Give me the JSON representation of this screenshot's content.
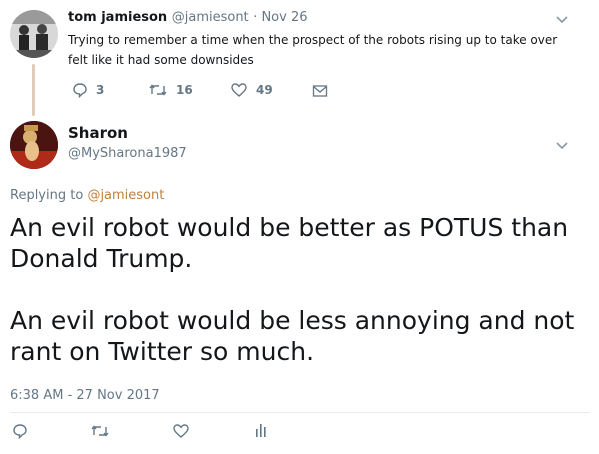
{
  "parent_tweet": {
    "name": "tom jamieson",
    "handle": "@jamiesont",
    "date": "· Nov 26",
    "text": "Trying to remember a time when the prospect of the robots rising up to take over felt like it had some downsides",
    "reply_count": "3",
    "retweet_count": "16",
    "like_count": "49"
  },
  "main_tweet": {
    "name": "Sharon",
    "handle": "@MySharona1987",
    "replying_to_prefix": "Replying to ",
    "replying_to_handle": "@jamiesont",
    "text_line1": "An evil robot would be better as POTUS than Donald Trump.",
    "text_line2": "An evil robot would be less annoying and not rant on Twitter so much.",
    "timestamp": "6:38 AM - 27 Nov 2017"
  },
  "icons": {
    "reply": "reply-icon",
    "retweet": "retweet-icon",
    "like": "heart-icon",
    "dm": "envelope-icon",
    "analytics": "bar-chart-icon",
    "more": "chevron-down-icon"
  },
  "colors": {
    "link": "#c08040",
    "muted": "#657786",
    "text": "#14171a"
  }
}
